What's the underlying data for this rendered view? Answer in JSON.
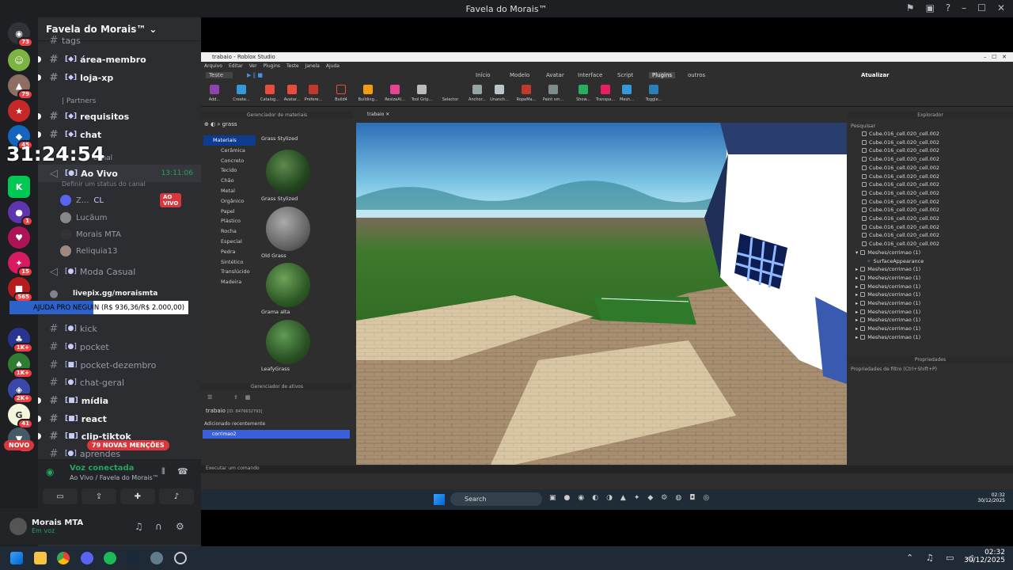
{
  "window": {
    "title": "Favela do Morais™"
  },
  "guild": {
    "name": "Favela do Morais™"
  },
  "clock": "31:24:54",
  "donation": {
    "text": "AJUDA PRO NEGUIN (R$ 936,36/R$ 2.000,00)",
    "progress_fraction": 0.47
  },
  "channels": {
    "top_partial": "tags",
    "area": "área-membro",
    "loja": "loja-xp",
    "partners_cat": "Partners",
    "requisitos": "requisitos",
    "chat": "chat",
    "canal_cat": "canal",
    "ao_vivo": "Ao Vivo",
    "ao_vivo_time": "13:11:06",
    "status_hint": "Definir um status do canal",
    "voice_users": [
      {
        "name": "Z...",
        "tag": "CL",
        "badge": "AO VIVO"
      },
      {
        "name": "Lucãum"
      },
      {
        "name": "Morais MTA"
      },
      {
        "name": "Reliquia13"
      }
    ],
    "moda_casual": "Moda Casual",
    "livepix": "livepix.gg/moraismta",
    "kick": "kick",
    "pocket": "pocket",
    "pocket_dezembro": "pocket-dezembro",
    "chat_geral": "chat-geral",
    "midia": "mídia",
    "react": "react",
    "clip": "clip-tiktok",
    "aprendizes": "aprendes"
  },
  "pills": {
    "new": "NOVO",
    "mentions": "79 NOVAS MENÇÕES"
  },
  "voice_panel": {
    "status": "Voz conectada",
    "location": "Ao Vivo / Favela do Morais™"
  },
  "user": {
    "name": "Morais MTA",
    "status": "Em voz"
  },
  "server_badges": [
    "73",
    "79",
    "45",
    "1",
    "15",
    "565",
    "1K+",
    "1K+",
    "2K+",
    "41",
    "34"
  ],
  "studio": {
    "title": "trabaio - Roblox Studio",
    "menu": [
      "Arquivo",
      "Editar",
      "Ver",
      "Plugins",
      "Teste",
      "Janela",
      "Ajuda"
    ],
    "mode": "Teste",
    "tabs": [
      "Início",
      "Modelo",
      "Avatar",
      "Interface",
      "Script",
      "Plugins",
      "outros"
    ],
    "active_tab": "Plugins",
    "update_label": "Atualizar",
    "ribbon": [
      "Add...",
      "Create...",
      "Catalog...",
      "Avatar...",
      "Prefere...",
      "Build4",
      "Building...",
      "ResizeAl...",
      "Tool Grip...",
      "Selector",
      "Anchor...",
      "Unanch...",
      "RopeMa...",
      "Paint sm...",
      "Show...",
      "Transpa...",
      "Mesh...",
      "Toggle..."
    ],
    "material_manager": {
      "title": "Gerenciador de materiais",
      "search": "grass",
      "categories": [
        "Materiais",
        "Cerâmica",
        "Concreto",
        "Tecido",
        "Chão",
        "Metal",
        "Orgânico",
        "Papel",
        "Plástico",
        "Rocha",
        "Especial",
        "Pedra",
        "Sintético",
        "Translúcido",
        "Madeira"
      ],
      "tiles": [
        "Grass Stylized",
        "Grass Stylized",
        "Old Grass",
        "Grama alta",
        "LeafyGrass"
      ]
    },
    "asset_manager": {
      "title": "Gerenciador de ativos",
      "place": "trabaio",
      "id": "[ID: 8476632793]",
      "recent": "Adicionado recentemente",
      "item": "corrimao2"
    },
    "viewport_tab": "trabaio",
    "explorer": {
      "title": "Explorador",
      "search": "Pesquisar",
      "cube_rows": [
        "Cube.016_cell.020_cell.002",
        "Cube.016_cell.020_cell.002",
        "Cube.016_cell.020_cell.002",
        "Cube.016_cell.020_cell.002",
        "Cube.016_cell.020_cell.002",
        "Cube.016_cell.020_cell.002",
        "Cube.016_cell.020_cell.002",
        "Cube.016_cell.020_cell.002",
        "Cube.016_cell.020_cell.002",
        "Cube.016_cell.020_cell.002",
        "Cube.016_cell.020_cell.002",
        "Cube.016_cell.020_cell.002",
        "Cube.016_cell.020_cell.002",
        "Cube.016_cell.020_cell.002"
      ],
      "mesh_open": "Meshes/corrimao (1)",
      "surface": "SurfaceAppearance",
      "mesh_rows": [
        "Meshes/corrimao (1)",
        "Meshes/corrimao (1)",
        "Meshes/corrimao (1)",
        "Meshes/corrimao (1)",
        "Meshes/corrimao (1)",
        "Meshes/corrimao (1)",
        "Meshes/corrimao (1)",
        "Meshes/corrimao (1)",
        "Meshes/corrimao (1)"
      ]
    },
    "properties": {
      "title": "Propriedades",
      "filter": "Propriedades de filtro (Ctrl+Shift+P)"
    },
    "command": "Executar um comando"
  },
  "inner_taskbar": {
    "search": "Search",
    "time": "02:32",
    "date": "30/12/2025"
  },
  "taskbar": {
    "time": "02:32",
    "date": "30/12/2025"
  }
}
